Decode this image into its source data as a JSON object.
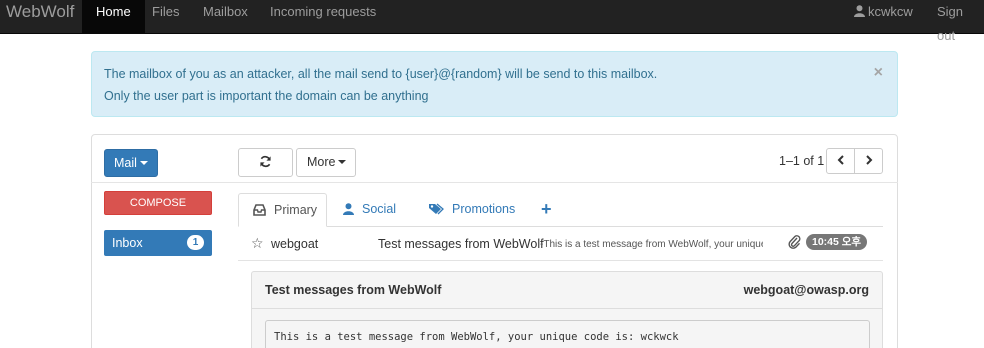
{
  "navbar": {
    "brand": "WebWolf",
    "items": [
      {
        "label": "Home",
        "active": true
      },
      {
        "label": "Files",
        "active": false
      },
      {
        "label": "Mailbox",
        "active": false
      },
      {
        "label": "Incoming requests",
        "active": false
      }
    ],
    "user": "kcwkcw",
    "user_icon": "user-icon",
    "sign_out": "Sign out"
  },
  "alert": {
    "line1": "The mailbox of you as an attacker, all the mail send to {user}@{random} will be send to this mailbox.",
    "line2": "Only the user part is important the domain can be anything",
    "close": "×"
  },
  "mail": {
    "mail_button": "Mail",
    "compose_button": "COMPOSE",
    "inbox_label": "Inbox",
    "inbox_count": "1",
    "more_button": "More",
    "refresh_icon": "refresh-icon",
    "pager": "1–1 of 1",
    "prev": "‹",
    "next": "›"
  },
  "tabs": [
    {
      "label": "Primary",
      "icon": "inbox-icon",
      "active": true
    },
    {
      "label": "Social",
      "icon": "user-icon",
      "active": false
    },
    {
      "label": "Promotions",
      "icon": "tag-icon",
      "active": false
    },
    {
      "label": "+",
      "icon": "plus-icon",
      "active": false
    }
  ],
  "message_list": [
    {
      "star": "☆",
      "sender": "webgoat",
      "subject": "Test messages from WebWolf",
      "snippet": " -This is a test message from WebWolf, your unique c",
      "has_attachment": true,
      "time": "10:45 오후"
    }
  ],
  "message_detail": {
    "title": "Test messages from WebWolf",
    "from": "webgoat@owasp.org",
    "body": "This is a test message from WebWolf, your unique code is: wckwck"
  },
  "colors": {
    "navbar_bg": "#222222",
    "primary": "#337ab7",
    "danger": "#d9534f",
    "alert_bg": "#d9edf7",
    "alert_text": "#31708f"
  }
}
